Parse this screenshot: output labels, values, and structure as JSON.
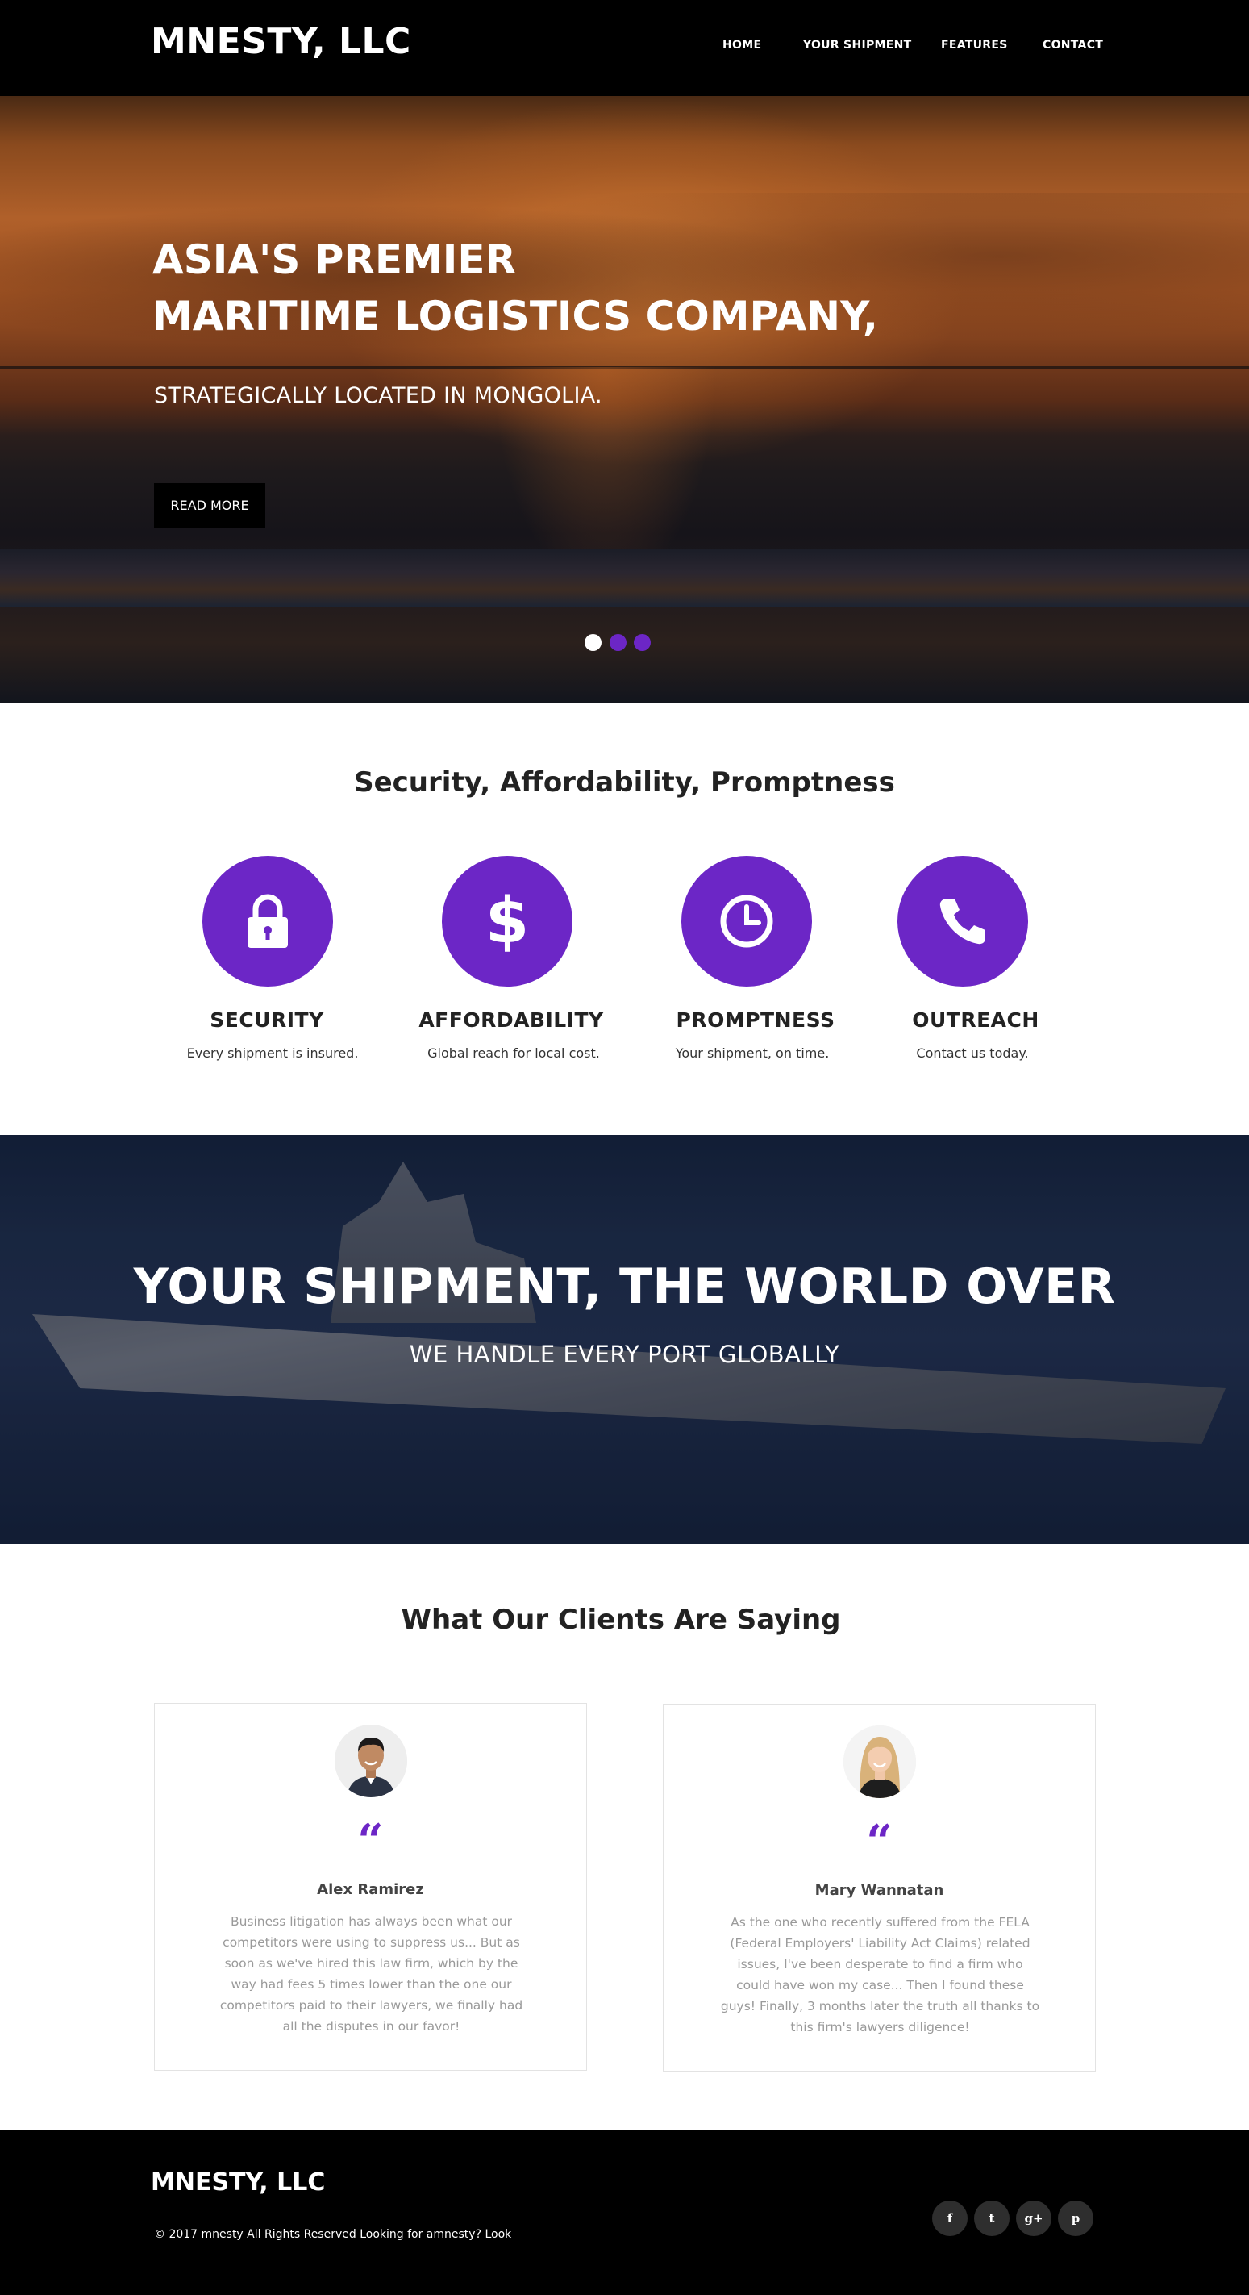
{
  "header": {
    "brand": "MNESTY, LLC",
    "nav": [
      "HOME",
      "YOUR SHIPMENT",
      "FEATURES",
      "CONTACT"
    ]
  },
  "hero": {
    "title_line1": "ASIA'S PREMIER",
    "title_line2": "MARITIME LOGISTICS COMPANY,",
    "subtitle": "STRATEGICALLY LOCATED IN MONGOLIA.",
    "button": "READ MORE",
    "slider_dots": [
      {
        "active": true,
        "color": "#ffffff"
      },
      {
        "active": false,
        "color": "#6c26c6"
      },
      {
        "active": false,
        "color": "#6c26c6"
      }
    ]
  },
  "features": {
    "title": "Security, Affordability, Promptness",
    "items": [
      {
        "icon": "lock-icon",
        "title": "SECURITY",
        "desc": "Every shipment is insured."
      },
      {
        "icon": "dollar-icon",
        "title": "AFFORDABILITY",
        "desc": "Global reach for local cost."
      },
      {
        "icon": "clock-icon",
        "title": "PROMPTNESS",
        "desc": "Your shipment, on time."
      },
      {
        "icon": "phone-icon",
        "title": "OUTREACH",
        "desc": "Contact us today."
      }
    ],
    "accent_color": "#6c26c6"
  },
  "ship_banner": {
    "title": "YOUR SHIPMENT, THE WORLD OVER",
    "subtitle": "WE HANDLE EVERY PORT GLOBALLY"
  },
  "testimonials": {
    "title": "What Our Clients Are Saying",
    "items": [
      {
        "name": "Alex Ramirez",
        "quote_icon": "quote-icon",
        "text": "Business litigation has always been what our competitors were using to suppress us... But as soon as we've hired this law firm, which by the way had fees 5 times lower than the one our competitors paid to their lawyers, we finally had all the disputes  in our favor!"
      },
      {
        "name": "Mary Wannatan",
        "quote_icon": "quote-icon",
        "text": "As the one who recently suffered from the FELA (Federal Employers' Liability Act Claims) related issues, I've been desperate to find a firm who could have won my case... Then I found these guys! Finally, 3 months later the truth all thanks to this firm's lawyers diligence!"
      }
    ]
  },
  "footer": {
    "brand": "MNESTY, LLC",
    "copyright": "© 2017 mnesty All Rights Reserved Looking for amnesty? Look",
    "social": [
      {
        "icon": "facebook-icon",
        "glyph": "f"
      },
      {
        "icon": "twitter-icon",
        "glyph": "t"
      },
      {
        "icon": "google-plus-icon",
        "glyph": "g+"
      },
      {
        "icon": "pinterest-icon",
        "glyph": "p"
      }
    ]
  }
}
